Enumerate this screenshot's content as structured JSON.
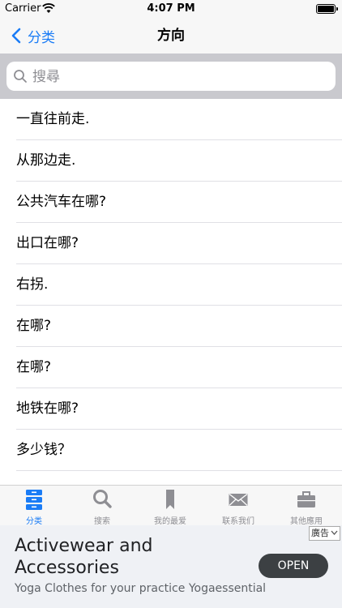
{
  "status": {
    "carrier": "Carrier",
    "time": "4:07 PM"
  },
  "nav": {
    "back_label": "分类",
    "title": "方向"
  },
  "search": {
    "placeholder": "搜尋"
  },
  "phrases": [
    "一直往前走.",
    "从那边走.",
    "公共汽车在哪?",
    "出口在哪?",
    "右拐.",
    "在哪?",
    "在哪?",
    "地铁在哪?",
    "多少钱？"
  ],
  "tabs": [
    {
      "label": "分类",
      "icon": "category-icon",
      "active": true
    },
    {
      "label": "搜索",
      "icon": "search-icon",
      "active": false
    },
    {
      "label": "我的最爱",
      "icon": "bookmark-icon",
      "active": false
    },
    {
      "label": "联系我们",
      "icon": "mail-icon",
      "active": false
    },
    {
      "label": "其他應用",
      "icon": "briefcase-icon",
      "active": false
    }
  ],
  "ad": {
    "tag": "廣告",
    "headline": "Activewear and Accessories",
    "subtitle": "Yoga Clothes for your practice Yogaessential",
    "button": "OPEN"
  },
  "colors": {
    "accent": "#1a7cf6",
    "inactive": "#8e8e93"
  }
}
